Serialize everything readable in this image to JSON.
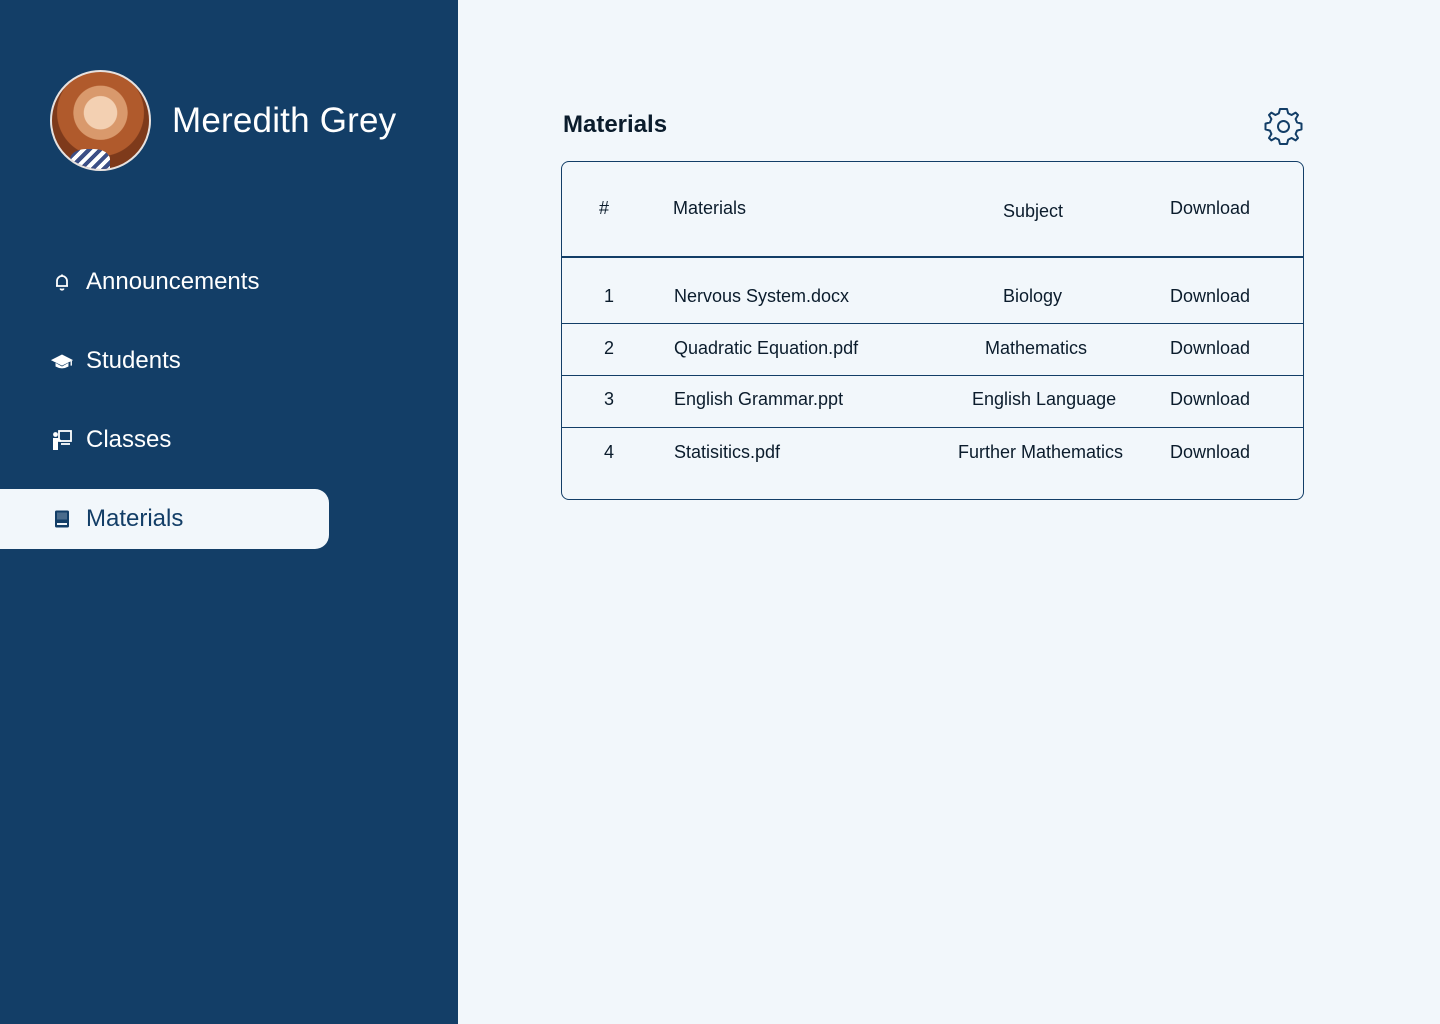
{
  "user": {
    "name": "Meredith Grey"
  },
  "nav": [
    {
      "label": "Announcements",
      "icon": "bell-icon"
    },
    {
      "label": "Students",
      "icon": "graduation-cap-icon"
    },
    {
      "label": "Classes",
      "icon": "teacher-board-icon"
    },
    {
      "label": "Materials",
      "icon": "book-icon",
      "active": true
    }
  ],
  "main": {
    "title": "Materials",
    "settings_icon": "gear-icon"
  },
  "table": {
    "headers": [
      "#",
      "Materials",
      "Subject",
      "Download"
    ],
    "rows": [
      {
        "num": "1",
        "material": "Nervous System.docx",
        "subject": "Biology",
        "download": "Download"
      },
      {
        "num": "2",
        "material": "Quadratic Equation.pdf",
        "subject": "Mathematics",
        "download": "Download"
      },
      {
        "num": "3",
        "material": "English Grammar.ppt",
        "subject": "English Language",
        "download": "Download"
      },
      {
        "num": "4",
        "material": "Statisitics.pdf",
        "subject": "Further Mathematics",
        "download": "Download"
      }
    ]
  },
  "colors": {
    "sidebar": "#133e67",
    "background": "#f2f7fb",
    "text": "#0b1c2c"
  }
}
